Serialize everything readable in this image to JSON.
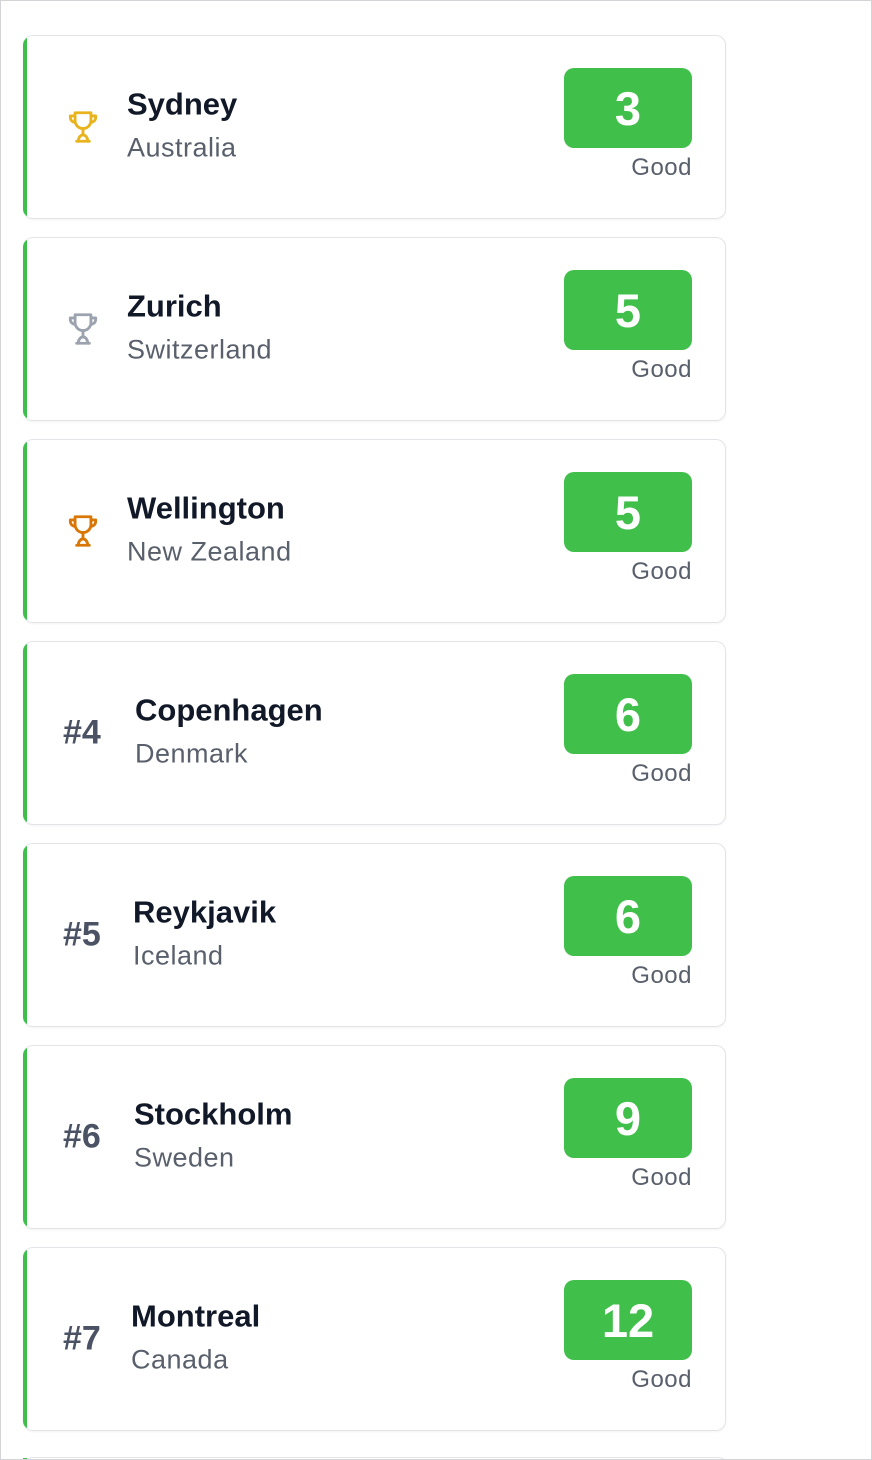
{
  "colors": {
    "accent_bar": "#3dbf4b",
    "score_badge": "#41bf4b",
    "gold_trophy": "#e8b31d",
    "silver_trophy": "#9ca3af",
    "bronze_trophy": "#d97706"
  },
  "rankings": [
    {
      "rank": 1,
      "rank_label": "",
      "icon": "gold-trophy-icon",
      "city": "Sydney",
      "country": "Australia",
      "score": "3",
      "status": "Good"
    },
    {
      "rank": 2,
      "rank_label": "",
      "icon": "silver-trophy-icon",
      "city": "Zurich",
      "country": "Switzerland",
      "score": "5",
      "status": "Good"
    },
    {
      "rank": 3,
      "rank_label": "",
      "icon": "bronze-trophy-icon",
      "city": "Wellington",
      "country": "New Zealand",
      "score": "5",
      "status": "Good"
    },
    {
      "rank": 4,
      "rank_label": "#4",
      "icon": "",
      "city": "Copenhagen",
      "country": "Denmark",
      "score": "6",
      "status": "Good"
    },
    {
      "rank": 5,
      "rank_label": "#5",
      "icon": "",
      "city": "Reykjavik",
      "country": "Iceland",
      "score": "6",
      "status": "Good"
    },
    {
      "rank": 6,
      "rank_label": "#6",
      "icon": "",
      "city": "Stockholm",
      "country": "Sweden",
      "score": "9",
      "status": "Good"
    },
    {
      "rank": 7,
      "rank_label": "#7",
      "icon": "",
      "city": "Montreal",
      "country": "Canada",
      "score": "12",
      "status": "Good"
    }
  ]
}
